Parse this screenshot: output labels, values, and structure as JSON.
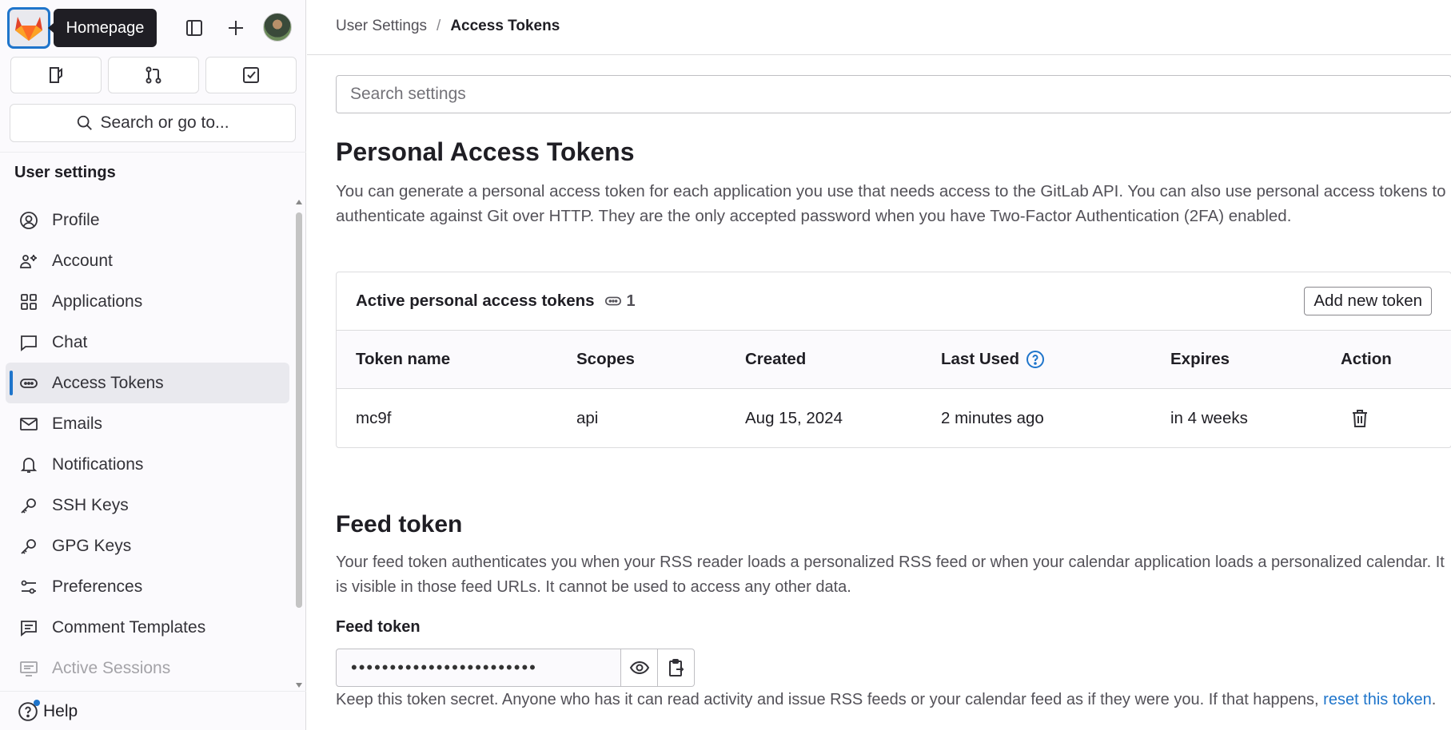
{
  "tooltip": "Homepage",
  "search_go": "Search or go to...",
  "sidebar": {
    "title": "User settings",
    "items": [
      {
        "label": "Profile",
        "icon": "profile-icon"
      },
      {
        "label": "Account",
        "icon": "account-icon"
      },
      {
        "label": "Applications",
        "icon": "applications-icon"
      },
      {
        "label": "Chat",
        "icon": "chat-icon"
      },
      {
        "label": "Access Tokens",
        "icon": "token-icon"
      },
      {
        "label": "Emails",
        "icon": "mail-icon"
      },
      {
        "label": "Notifications",
        "icon": "bell-icon"
      },
      {
        "label": "SSH Keys",
        "icon": "key-icon"
      },
      {
        "label": "GPG Keys",
        "icon": "key-icon"
      },
      {
        "label": "Preferences",
        "icon": "preferences-icon"
      },
      {
        "label": "Comment Templates",
        "icon": "comment-icon"
      },
      {
        "label": "Active Sessions",
        "icon": "monitor-icon"
      }
    ],
    "active": "Access Tokens",
    "help": "Help"
  },
  "breadcrumb": {
    "parent": "User Settings",
    "sep": "/",
    "current": "Access Tokens"
  },
  "search_settings": {
    "placeholder": "Search settings"
  },
  "pat": {
    "title": "Personal Access Tokens",
    "description": "You can generate a personal access token for each application you use that needs access to the GitLab API. You can also use personal access tokens to authenticate against Git over HTTP. They are the only accepted password when you have Two-Factor Authentication (2FA) enabled.",
    "card_title": "Active personal access tokens",
    "count": "1",
    "add_button": "Add new token",
    "columns": [
      "Token name",
      "Scopes",
      "Created",
      "Last Used",
      "Expires",
      "Action"
    ],
    "rows": [
      {
        "name": "mc9f",
        "scopes": "api",
        "created": "Aug 15, 2024",
        "last_used": "2 minutes ago",
        "expires": "in 4 weeks"
      }
    ]
  },
  "feed": {
    "title": "Feed token",
    "description": "Your feed token authenticates you when your RSS reader loads a personalized RSS feed or when your calendar application loads a personalized calendar. It is visible in those feed URLs. It cannot be used to access any other data.",
    "label": "Feed token",
    "masked_value": "••••••••••••••••••••••••",
    "help_prefix": "Keep this token secret. Anyone who has it can read activity and issue RSS feeds or your calendar feed as if they were you. If that happens, ",
    "help_link": "reset this token",
    "help_suffix": "."
  },
  "colors": {
    "accent": "#1f75cb",
    "tanuki": "#e24329"
  }
}
